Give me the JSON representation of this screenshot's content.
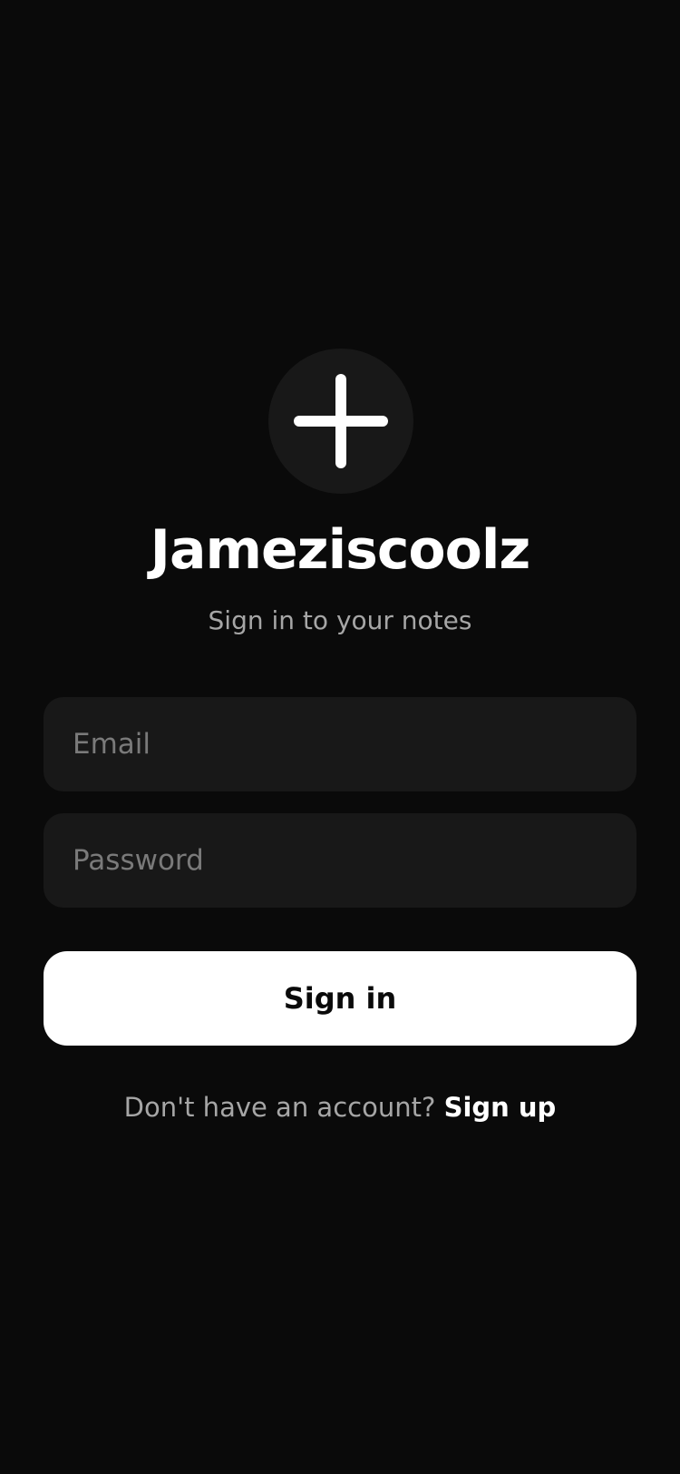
{
  "app": {
    "title": "Jameziscoolz",
    "subtitle": "Sign in to your notes",
    "logo_icon": "plus-icon"
  },
  "form": {
    "email": {
      "value": "",
      "placeholder": "Email"
    },
    "password": {
      "value": "",
      "placeholder": "Password"
    },
    "submit_label": "Sign in"
  },
  "footer": {
    "prompt": "Don't have an account? ",
    "link_label": "Sign up"
  },
  "colors": {
    "background": "#0a0a0a",
    "surface": "#181818",
    "primary": "#ffffff",
    "muted_text": "#a6a6a6",
    "placeholder_text": "#7a7a7a"
  }
}
